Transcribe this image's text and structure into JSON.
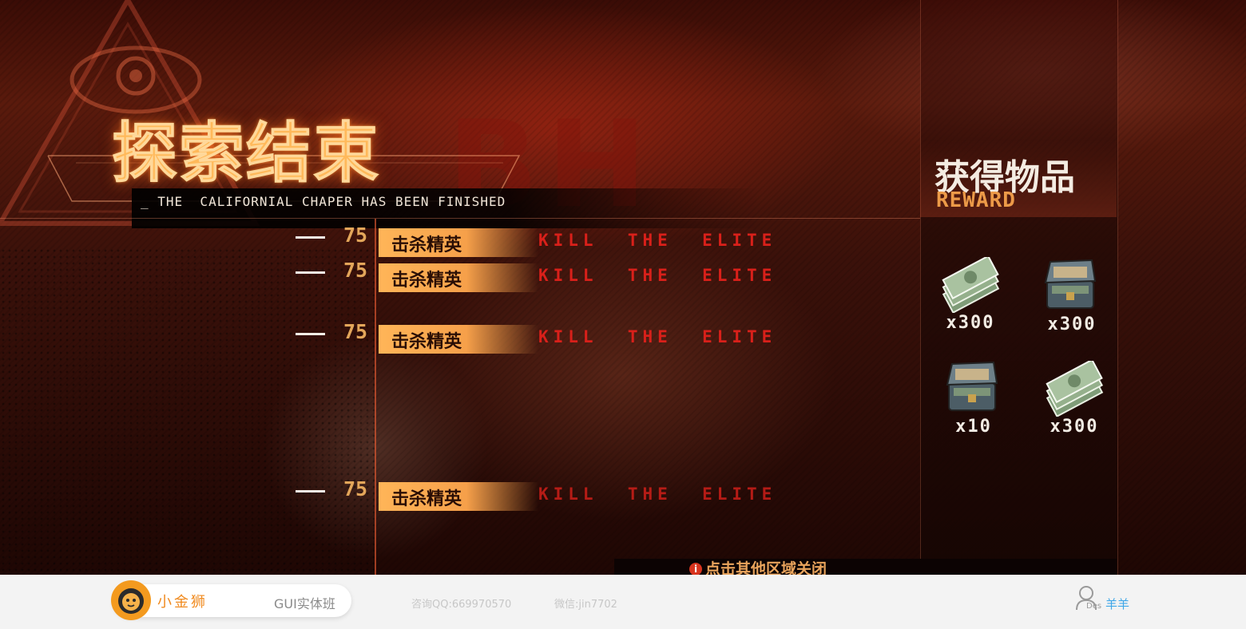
{
  "title": "探索结束",
  "subtitle": "_ THE  CALIFORNIAL CHAPER HAS BEEN FINISHED",
  "objectives": [
    {
      "points": "75",
      "label": "击杀精英",
      "label_en": "KILL  THE  ELITE"
    },
    {
      "points": "75",
      "label": "击杀精英",
      "label_en": "KILL  THE  ELITE"
    },
    {
      "points": "75",
      "label": "击杀精英",
      "label_en": "KILL  THE  ELITE"
    },
    {
      "points": "75",
      "label": "击杀精英",
      "label_en": "KILL  THE  ELITE"
    }
  ],
  "rewards": {
    "title": "获得物品",
    "subtitle": "REWARD",
    "items": [
      {
        "icon": "cash-stack-icon",
        "quantity": "x300"
      },
      {
        "icon": "treasure-chest-icon",
        "quantity": "x300"
      },
      {
        "icon": "treasure-chest-icon",
        "quantity": "x10"
      },
      {
        "icon": "cash-stack-icon",
        "quantity": "x300"
      }
    ]
  },
  "close_hint": "点击其他区域关闭",
  "footer": {
    "brand": "小金狮",
    "course": "GUI实体班",
    "qq": "咨询QQ:669970570",
    "wechat": "微信:jin7702",
    "user_label": "Des",
    "user_name": "羊羊"
  },
  "colors": {
    "accent_orange": "#ffb558",
    "title_glow": "#ffb95a",
    "elite_red": "#d9201a",
    "footer_bg": "#f3f3f3",
    "brand_orange": "#f08a1e",
    "user_blue": "#3fa7e8"
  }
}
